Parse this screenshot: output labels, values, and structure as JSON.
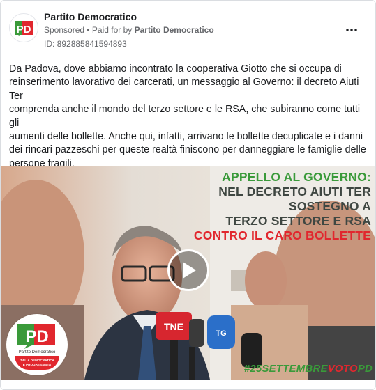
{
  "post": {
    "page_name": "Partito Democratico",
    "sponsored_label": "Sponsored",
    "separator": " • ",
    "paid_for_prefix": "Paid for by ",
    "paid_for_by": "Partito Democratico",
    "ad_id": "ID: 892885841594893",
    "more_icon": "more-horizontal-icon",
    "text": "Da Padova, dove abbiamo incontrato la cooperativa Giotto che si occupa di\nreinserimento lavorativo dei carcerati, un messaggio al Governo: il decreto Aiuti Ter\ncomprenda anche il mondo del terzo settore e le RSA, che subiranno come tutti gli\naumenti delle bollette. Anche qui, infatti, arrivano le bollette decuplicate e i danni\ndei rincari pazzeschi per queste realtà finiscono per danneggiare le famiglie delle\npersone fragili.\nPer noi è prioritario intervenire per non lasciare indietro chi aiuta i più deboli...."
  },
  "avatar": {
    "logo_text": "PD"
  },
  "video": {
    "overlay": [
      "APPELLO AL GOVERNO:",
      "NEL DECRETO AIUTI TER",
      "SOSTEGNO A",
      "TERZO SETTORE E RSA",
      "CONTRO IL CARO BOLLETTE"
    ],
    "hashtag_part1": "#25SETTEMBRE",
    "hashtag_part2": "VOTO",
    "hashtag_part3": "PD",
    "mic_labels": [
      "TNE",
      "TG"
    ],
    "logo": {
      "letters": "PD",
      "subtitle": "Partito Democratico",
      "band_line1": "ITALIA DEMOCRATICA",
      "band_line2": "E PROGRESSISTA"
    },
    "play_icon": "play-icon"
  },
  "colors": {
    "green": "#3a9a3a",
    "red": "#e1272e",
    "dark": "#3f4742",
    "text_secondary": "#65676b"
  }
}
